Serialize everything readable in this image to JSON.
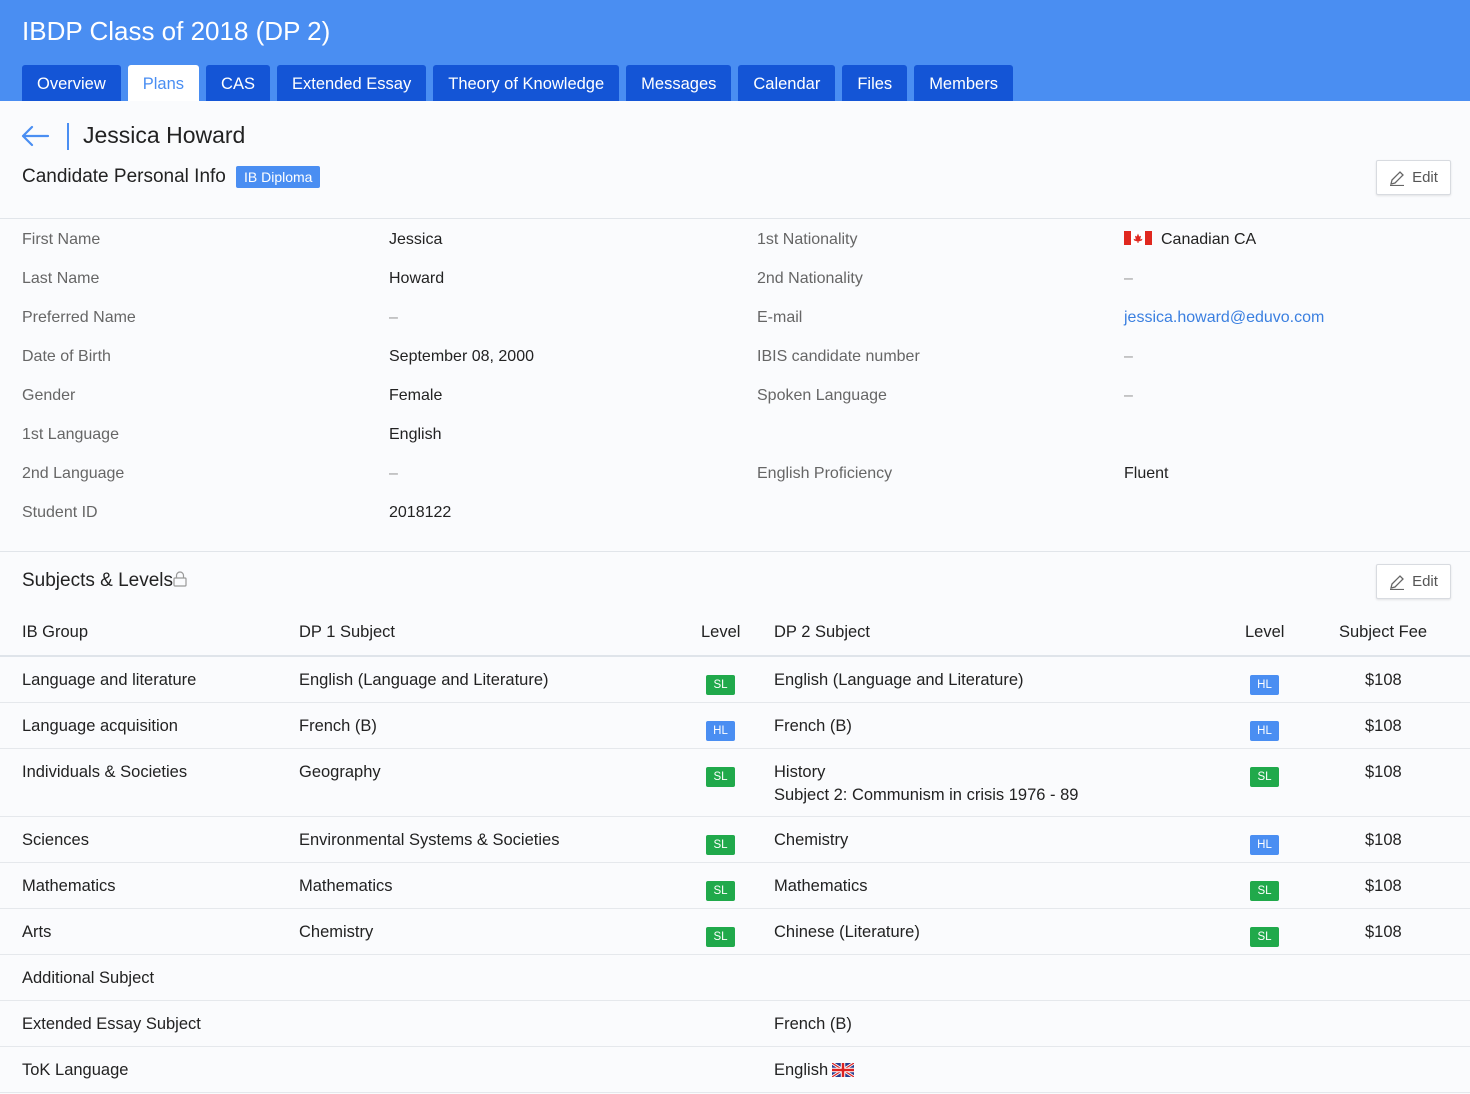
{
  "header": {
    "title": "IBDP Class of 2018 (DP 2)",
    "tabs": [
      {
        "label": "Overview"
      },
      {
        "label": "Plans",
        "active": true
      },
      {
        "label": "CAS"
      },
      {
        "label": "Extended Essay"
      },
      {
        "label": "Theory of Knowledge"
      },
      {
        "label": "Messages"
      },
      {
        "label": "Calendar"
      },
      {
        "label": "Files"
      },
      {
        "label": "Members"
      }
    ]
  },
  "student": {
    "name": "Jessica Howard"
  },
  "personal_info": {
    "title": "Candidate Personal Info",
    "badge": "IB Diploma",
    "edit_label": "Edit",
    "left": [
      {
        "label": "First Name",
        "value": "Jessica"
      },
      {
        "label": "Last Name",
        "value": "Howard"
      },
      {
        "label": "Preferred Name",
        "value": "–"
      },
      {
        "label": "Date of Birth",
        "value": "September 08, 2000"
      },
      {
        "label": "Gender",
        "value": "Female"
      },
      {
        "label": "1st Language",
        "value": "English"
      },
      {
        "label": "2nd Language",
        "value": "–"
      },
      {
        "label": "Student ID",
        "value": "2018122"
      }
    ],
    "right": [
      {
        "label": "1st Nationality",
        "value": "Canadian CA"
      },
      {
        "label": "2nd Nationality",
        "value": "–"
      },
      {
        "label": "E-mail",
        "value": "jessica.howard@eduvo.com"
      },
      {
        "label": "IBIS candidate number",
        "value": "–"
      },
      {
        "label": "Spoken Language",
        "value": "–"
      },
      {
        "label": "English Proficiency",
        "value": "Fluent"
      }
    ]
  },
  "subjects": {
    "title": "Subjects & Levels",
    "edit_label": "Edit",
    "columns": {
      "group": "IB Group",
      "dp1": "DP 1 Subject",
      "level1": "Level",
      "dp2": "DP 2 Subject",
      "level2": "Level",
      "fee": "Subject Fee"
    },
    "rows": [
      {
        "group": "Language and literature",
        "dp1": "English (Language and Literature)",
        "level1": "SL",
        "dp2": "English (Language and Literature)",
        "level2": "HL",
        "fee": "$108"
      },
      {
        "group": "Language acquisition",
        "dp1": "French (B)",
        "level1": "HL",
        "dp2": "French (B)",
        "level2": "HL",
        "fee": "$108"
      },
      {
        "group": "Individuals & Societies",
        "dp1": "Geography",
        "level1": "SL",
        "dp2": "History",
        "dp2_sub": "Subject 2: Communism in crisis 1976 - 89",
        "level2": "SL",
        "fee": "$108"
      },
      {
        "group": "Sciences",
        "dp1": "Environmental Systems & Societies",
        "level1": "SL",
        "dp2": "Chemistry",
        "level2": "HL",
        "fee": "$108"
      },
      {
        "group": "Mathematics",
        "dp1": "Mathematics",
        "level1": "SL",
        "dp2": "Mathematics",
        "level2": "SL",
        "fee": "$108"
      },
      {
        "group": "Arts",
        "dp1": "Chemistry",
        "level1": "SL",
        "dp2": "Chinese (Literature)",
        "level2": "SL",
        "fee": "$108"
      }
    ],
    "extra_rows": [
      {
        "label": "Additional Subject",
        "value": ""
      },
      {
        "label": "Extended Essay Subject",
        "value": "French (B)"
      },
      {
        "label": "ToK Language",
        "value": "English"
      }
    ]
  },
  "colors": {
    "header_bg": "#4a8ef2",
    "tab_bg": "#1455d6",
    "sl_badge": "#20a94b",
    "hl_badge": "#4a8ef2",
    "link": "#3a7fe0"
  },
  "icons": [
    "arrow-left-icon",
    "pencil-icon",
    "lock-icon",
    "flag-canada-icon",
    "flag-uk-icon"
  ]
}
